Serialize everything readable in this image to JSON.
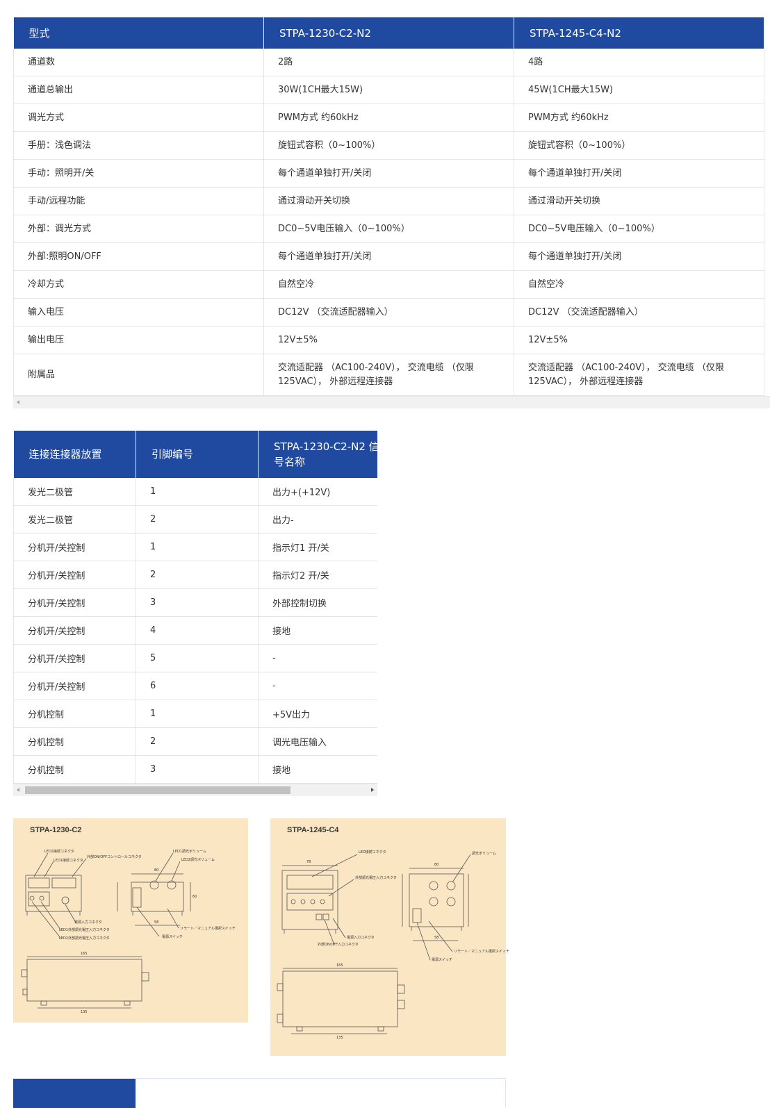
{
  "spec_table": {
    "headers": [
      "型式",
      "STPA-1230-C2-N2",
      "STPA-1245-C4-N2"
    ],
    "rows": [
      [
        "通道数",
        "2路",
        "4路"
      ],
      [
        "通道总输出",
        "30W(1CH最大15W)",
        "45W(1CH最大15W)"
      ],
      [
        "调光方式",
        "PWM方式 约60kHz",
        "PWM方式 约60kHz"
      ],
      [
        "手册：浅色调法",
        "旋钮式容积（0~100%）",
        "旋钮式容积（0~100%）"
      ],
      [
        "手动：照明开/关",
        "每个通道单独打开/关闭",
        "每个通道单独打开/关闭"
      ],
      [
        "手动/远程功能",
        "通过滑动开关切换",
        "通过滑动开关切换"
      ],
      [
        "外部：调光方式",
        "DC0~5V电压输入（0~100%）",
        "DC0~5V电压输入（0~100%）"
      ],
      [
        "外部:照明ON/OFF",
        "每个通道单独打开/关闭",
        "每个通道单独打开/关闭"
      ],
      [
        "冷却方式",
        "自然空冷",
        "自然空冷"
      ],
      [
        "输入电压",
        "DC12V （交流适配器输入）",
        "DC12V （交流适配器输入）"
      ],
      [
        "输出电压",
        "12V±5%",
        "12V±5%"
      ],
      [
        "附属品",
        "交流适配器 （AC100-240V）， 交流电缆 （仅限125VAC）， 外部远程连接器",
        "交流适配器 （AC100-240V）， 交流电缆 （仅限125VAC）， 外部远程连接器"
      ]
    ]
  },
  "pin_table": {
    "headers": [
      "连接连接器放置",
      "引脚编号",
      "STPA-1230-C2-N2 信号名称"
    ],
    "rows": [
      [
        "发光二极管",
        "1",
        "出力+(+12V)"
      ],
      [
        "发光二极管",
        "2",
        "出力-"
      ],
      [
        "分机开/关控制",
        "1",
        "指示灯1 开/关"
      ],
      [
        "分机开/关控制",
        "2",
        "指示灯2 开/关"
      ],
      [
        "分机开/关控制",
        "3",
        "外部控制切换"
      ],
      [
        "分机开/关控制",
        "4",
        "接地"
      ],
      [
        "分机开/关控制",
        "5",
        "-"
      ],
      [
        "分机开/关控制",
        "6",
        "-"
      ],
      [
        "分机控制",
        "1",
        "+5V出力"
      ],
      [
        "分机控制",
        "2",
        "调光电压输入"
      ],
      [
        "分机控制",
        "3",
        "接地"
      ]
    ]
  },
  "drawings": [
    {
      "title": "STPA-1230-C2",
      "labels": {
        "led2_connector": "LED2接続コネクタ",
        "led1_connector": "LED1接続コネクタ",
        "ext_onoff": "外部ON/OFFコントロールコネクタ",
        "led1_vol": "LED1調光ボリューム",
        "led2_vol": "LED2調光ボリューム",
        "power_in": "電源入力コネクタ",
        "led1_ext": "LED1外部調光電圧入力コネクタ",
        "led2_ext": "LED2外部調光電圧入力コネクタ",
        "remote_sw": "リモート／マニュアル選択スイッチ",
        "power_sw": "電源スイッチ",
        "dim_80": "80",
        "dim_58": "58",
        "dim_60": "60",
        "dim_165": "165",
        "dim_135": "135"
      }
    },
    {
      "title": "STPA-1245-C4",
      "labels": {
        "led_connector": "LED接続コネクタ",
        "vol": "調光ボリューム",
        "ext_v": "外部調光電圧入力コネクタ",
        "power_in": "電源入力コネクタ",
        "ext_onoff": "外部ON/OFF入力コネクタ",
        "remote_sw": "リモート／マニュアル選択スイッチ",
        "power_sw": "電源スイッチ",
        "dim_78": "78",
        "dim_80": "80",
        "dim_58": "58",
        "dim_165": "165",
        "dim_135": "135"
      }
    }
  ]
}
